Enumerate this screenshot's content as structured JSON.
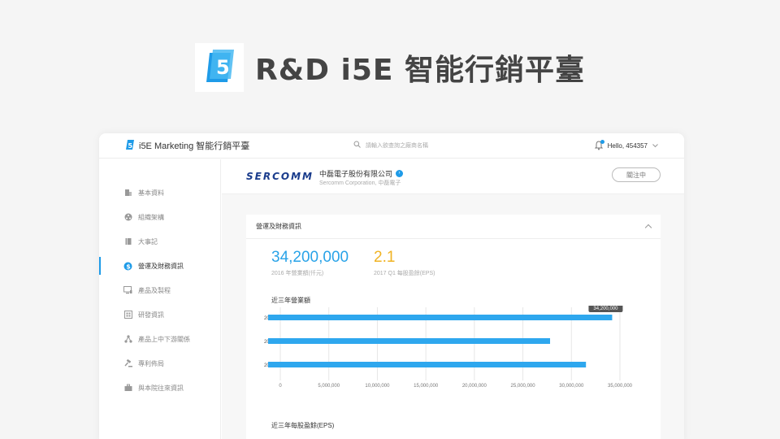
{
  "hero": {
    "title": "R&D i5E 智能行銷平臺"
  },
  "topbar": {
    "app_name": "i5E Marketing 智能行銷平臺",
    "search_placeholder": "請輸入欲查詢之廠商名稱",
    "greeting": "Hello, 454357"
  },
  "sidebar": {
    "items": [
      {
        "label": "基本資料",
        "icon": "building-icon"
      },
      {
        "label": "組織架構",
        "icon": "org-icon"
      },
      {
        "label": "大事記",
        "icon": "book-icon"
      },
      {
        "label": "營運及財務資訊",
        "icon": "dollar-icon",
        "active": true
      },
      {
        "label": "產品及製程",
        "icon": "monitor-icon"
      },
      {
        "label": "研發資訊",
        "icon": "grid-icon"
      },
      {
        "label": "產品上中下游關係",
        "icon": "hierarchy-icon"
      },
      {
        "label": "專利佈局",
        "icon": "gavel-icon"
      },
      {
        "label": "與本院往來資訊",
        "icon": "briefcase-icon"
      }
    ]
  },
  "company": {
    "logo_text": "SERCOMM",
    "name": "中磊電子股份有限公司",
    "sub": "Sercomm Corporation, 中磊電子",
    "follow_label": "關注中"
  },
  "section": {
    "title": "營運及財務資訊",
    "revenue_value": "34,200,000",
    "revenue_label": "2016 年營業額(仟元)",
    "eps_value": "2.1",
    "eps_label": "2017 Q1 每股盈餘(EPS)",
    "revenue_chart_title": "近三年營業額",
    "eps_chart_title": "近三年每股盈餘(EPS)"
  },
  "colors": {
    "accent": "#1e9be8",
    "kpi_blue": "#29a3e8",
    "kpi_yellow": "#f0b323",
    "bar": "#2ea7ee"
  },
  "chart_data": {
    "type": "bar",
    "orientation": "horizontal",
    "categories": [
      "2016",
      "2015",
      "2014"
    ],
    "values": [
      34200000,
      27800000,
      31500000
    ],
    "xlim": [
      0,
      35000000
    ],
    "xticks": [
      "0",
      "5,000,000",
      "10,000,000",
      "15,000,000",
      "20,000,000",
      "25,000,000",
      "30,000,000",
      "35,000,000"
    ],
    "tooltip": "34,200,000",
    "grid": true
  }
}
